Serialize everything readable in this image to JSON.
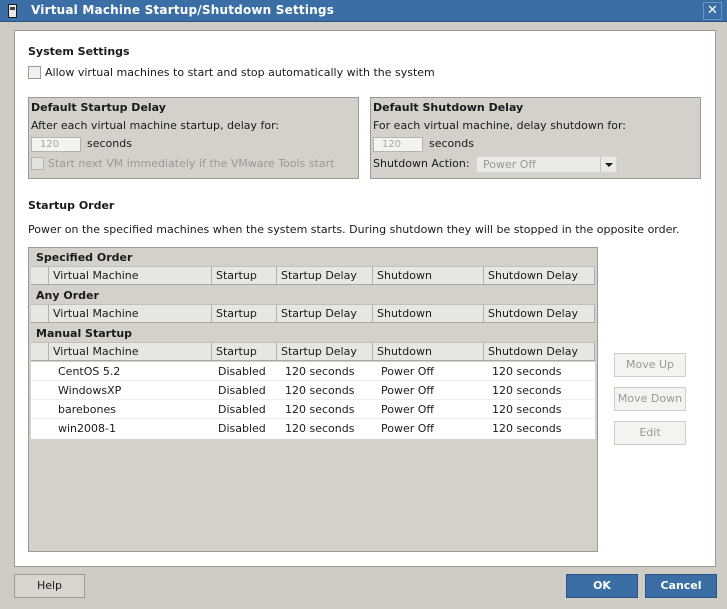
{
  "window": {
    "title": "Virtual Machine Startup/Shutdown Settings",
    "close_icon": "close-icon",
    "app_icon": "vm-icon"
  },
  "system_settings": {
    "heading": "System Settings",
    "auto_start_label": "Allow virtual machines to start and stop automatically with the system",
    "auto_start_checked": false
  },
  "startup_delay": {
    "heading": "Default Startup Delay",
    "description": "After each virtual machine startup, delay for:",
    "value": "120",
    "unit": "seconds",
    "tools_checkbox_label": "Start next VM immediately if the VMware Tools start",
    "tools_checkbox_checked": false
  },
  "shutdown_delay": {
    "heading": "Default Shutdown Delay",
    "description": "For each virtual machine, delay shutdown for:",
    "value": "120",
    "unit": "seconds",
    "action_label": "Shutdown Action:",
    "action_value": "Power Off"
  },
  "startup_order": {
    "heading": "Startup Order",
    "description": "Power on the specified machines when the system starts. During shutdown they will be stopped in the opposite order.",
    "columns": [
      "Virtual Machine",
      "Startup",
      "Startup Delay",
      "Shutdown",
      "Shutdown Delay"
    ],
    "sections": [
      {
        "title": "Specified Order",
        "rows": []
      },
      {
        "title": "Any Order",
        "rows": []
      },
      {
        "title": "Manual Startup",
        "rows": [
          {
            "vm": "CentOS 5.2",
            "startup": "Disabled",
            "startup_delay": "120 seconds",
            "shutdown": "Power Off",
            "shutdown_delay": "120 seconds"
          },
          {
            "vm": "WindowsXP",
            "startup": "Disabled",
            "startup_delay": "120 seconds",
            "shutdown": "Power Off",
            "shutdown_delay": "120 seconds"
          },
          {
            "vm": "barebones",
            "startup": "Disabled",
            "startup_delay": "120 seconds",
            "shutdown": "Power Off",
            "shutdown_delay": "120 seconds"
          },
          {
            "vm": "win2008-1",
            "startup": "Disabled",
            "startup_delay": "120 seconds",
            "shutdown": "Power Off",
            "shutdown_delay": "120 seconds"
          }
        ]
      }
    ]
  },
  "side_buttons": {
    "move_up": "Move Up",
    "move_down": "Move Down",
    "edit": "Edit"
  },
  "footer": {
    "help": "Help",
    "ok": "OK",
    "cancel": "Cancel"
  },
  "colors": {
    "accent": "#3a6ea5",
    "panel_bg": "#d4d1cb",
    "disabled_text": "#9b9994"
  }
}
